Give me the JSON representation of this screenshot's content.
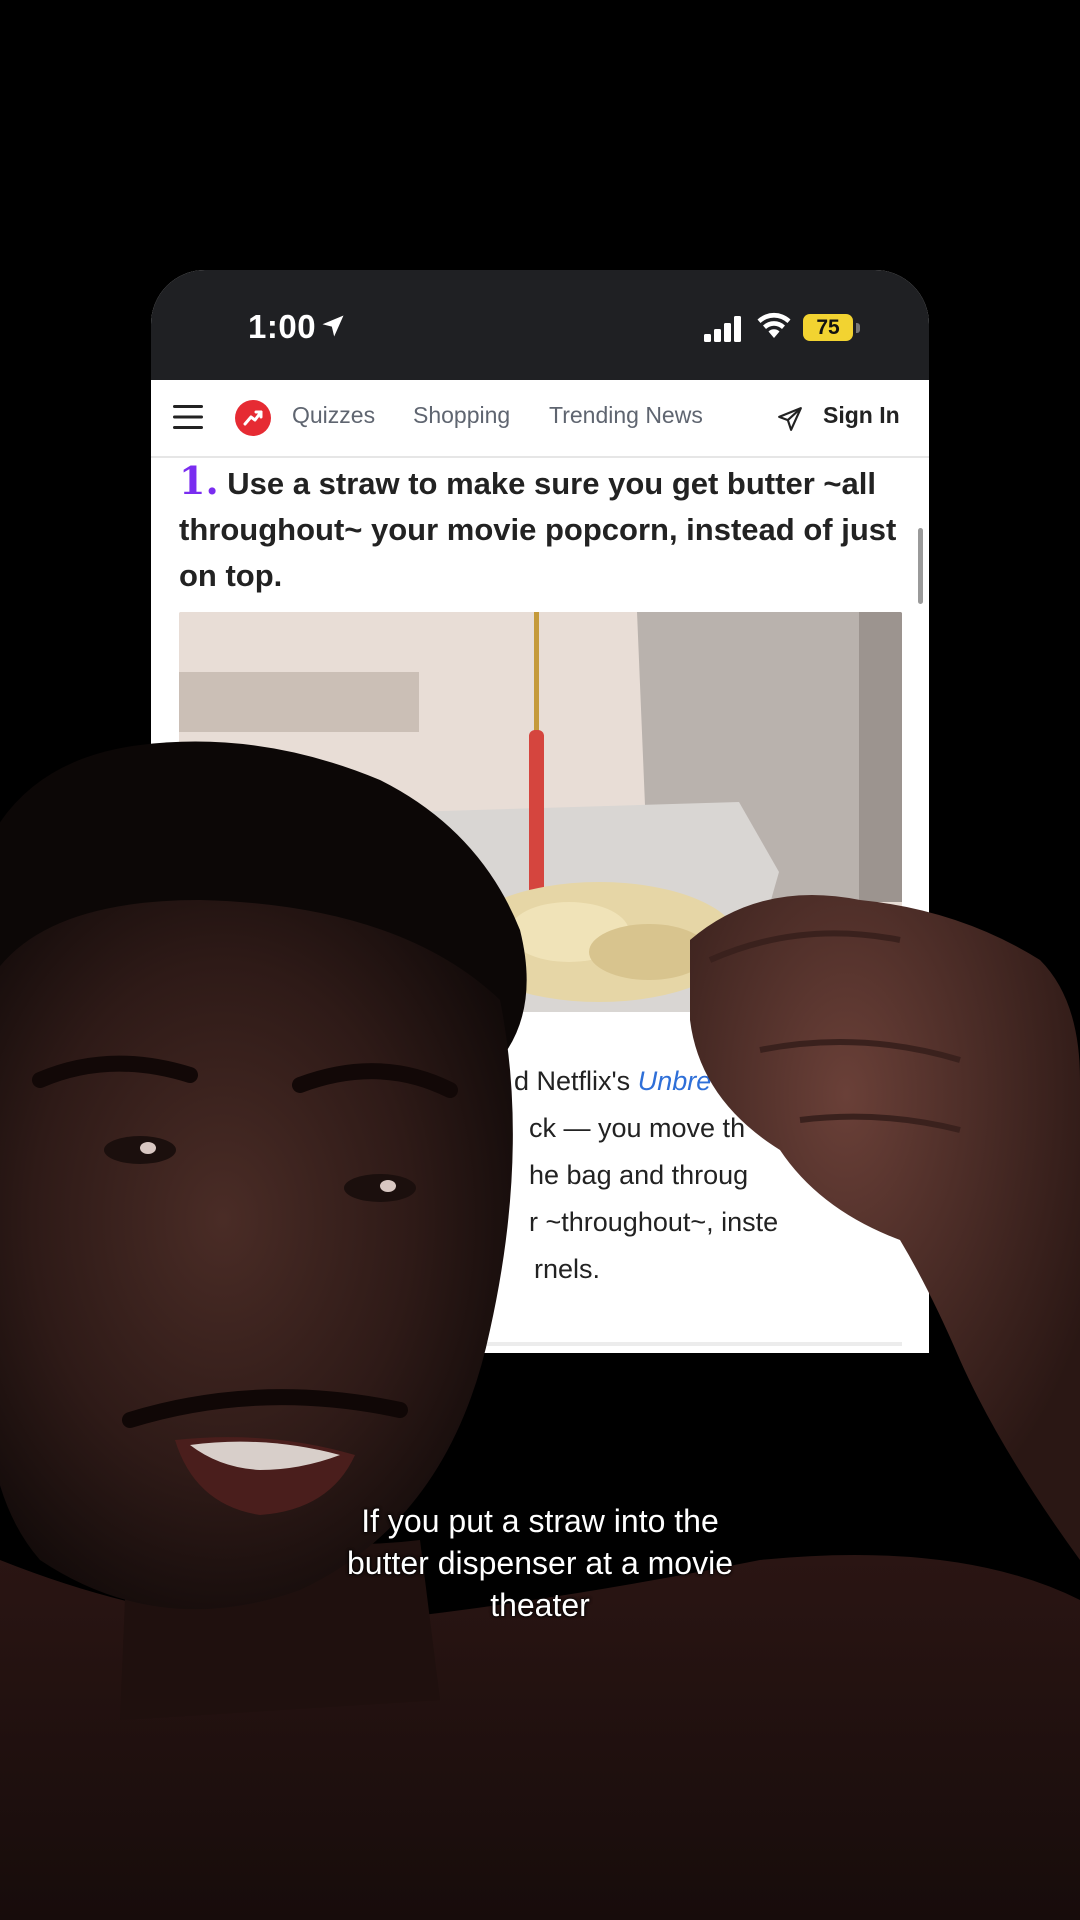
{
  "status_bar": {
    "time": "1:00",
    "battery": "75"
  },
  "nav": {
    "links": [
      "Quizzes",
      "Shopping",
      "Trending News"
    ],
    "sign_in": "Sign In"
  },
  "article": {
    "number": "1.",
    "heading": "Use a straw to make sure you get butter ~all throughout~ your movie popcorn, instead of just on top.",
    "body_lines": [
      "d Netflix's ",
      "ck — you move th",
      "he bag and throug",
      "r ~throughout~, inste",
      "rnels."
    ],
    "body_link": "Unbre"
  },
  "caption": {
    "lines": [
      "If you put a straw into the",
      "butter dispenser at a movie",
      "theater"
    ]
  },
  "colors": {
    "accent_number": "#7a2df0",
    "logo": "#e62b33",
    "battery": "#f2d331",
    "link": "#2e6fd8"
  },
  "icons": [
    "location-arrow-icon",
    "signal-icon",
    "wifi-icon",
    "battery-icon",
    "menu-icon",
    "trending-logo-icon",
    "send-icon"
  ]
}
